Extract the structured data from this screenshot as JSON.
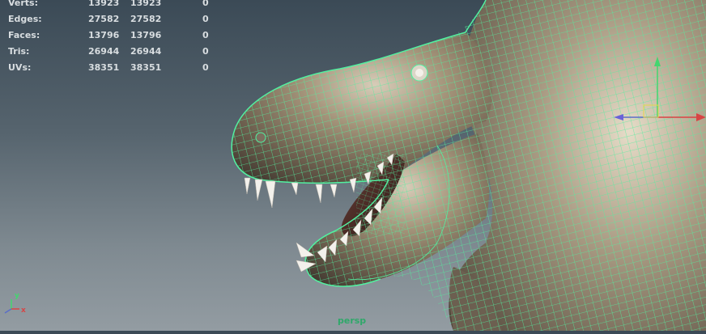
{
  "hud": {
    "stats": [
      {
        "label": "Verts:",
        "object": "13923",
        "selected": "13923",
        "components": "0"
      },
      {
        "label": "Edges:",
        "object": "27582",
        "selected": "27582",
        "components": "0"
      },
      {
        "label": "Faces:",
        "object": "13796",
        "selected": "13796",
        "components": "0"
      },
      {
        "label": "Tris:",
        "object": "26944",
        "selected": "26944",
        "components": "0"
      },
      {
        "label": "UVs:",
        "object": "38351",
        "selected": "38351",
        "components": "0"
      }
    ]
  },
  "viewport": {
    "camera": "persp",
    "axis": {
      "y": "y",
      "x": "x"
    }
  },
  "colors": {
    "wireframe": "#52f0a0",
    "skin": "#9f8f77",
    "text": "#d8dde0",
    "camera_label": "#2fa86a"
  }
}
